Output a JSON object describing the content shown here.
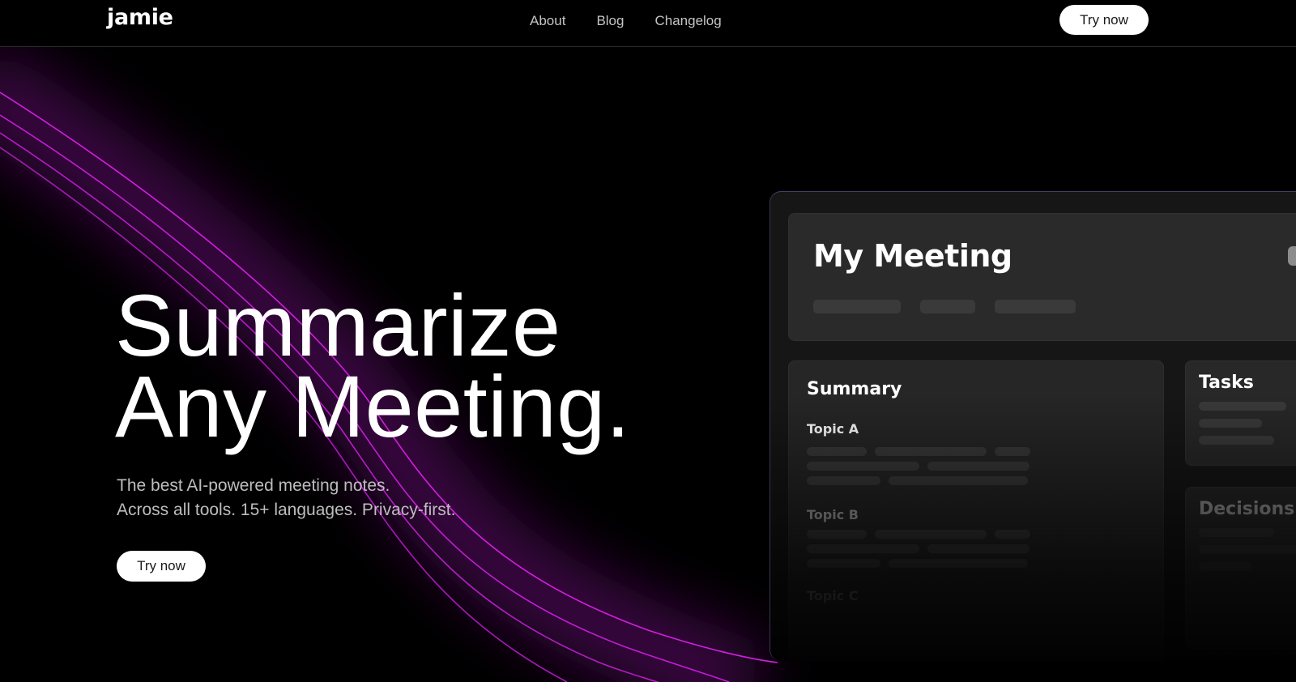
{
  "nav": {
    "logo": "jamie",
    "links": [
      "About",
      "Blog",
      "Changelog"
    ],
    "cta_label": "Try now"
  },
  "hero": {
    "title_line1": "Summarize",
    "title_line2": "Any Meeting.",
    "subtitle_line1": "The best AI-powered meeting notes.",
    "subtitle_line2": "Across all tools. 15+ languages. Privacy-first.",
    "cta_label": "Try now"
  },
  "mockup": {
    "meeting_title": "My Meeting",
    "summary": {
      "heading": "Summary",
      "topics": [
        "Topic A",
        "Topic B",
        "Topic C"
      ]
    },
    "tasks_heading": "Tasks",
    "decisions_heading": "Decisions"
  },
  "colors": {
    "background": "#000000",
    "accent_curve": "#c81ed6",
    "glow": "#5a0a66",
    "card": "#2a2a2a",
    "button_bg": "#ffffff"
  }
}
